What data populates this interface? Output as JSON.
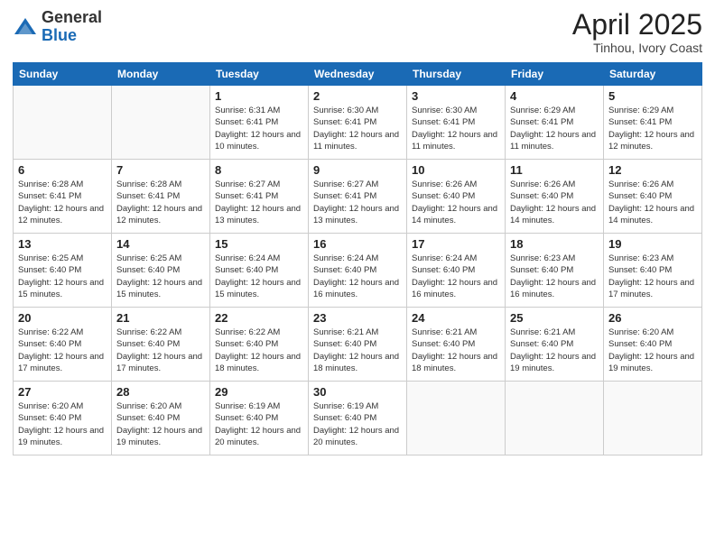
{
  "logo": {
    "general": "General",
    "blue": "Blue"
  },
  "title": {
    "month": "April 2025",
    "location": "Tinhou, Ivory Coast"
  },
  "days_of_week": [
    "Sunday",
    "Monday",
    "Tuesday",
    "Wednesday",
    "Thursday",
    "Friday",
    "Saturday"
  ],
  "weeks": [
    [
      {
        "day": "",
        "info": ""
      },
      {
        "day": "",
        "info": ""
      },
      {
        "day": "1",
        "info": "Sunrise: 6:31 AM\nSunset: 6:41 PM\nDaylight: 12 hours and 10 minutes."
      },
      {
        "day": "2",
        "info": "Sunrise: 6:30 AM\nSunset: 6:41 PM\nDaylight: 12 hours and 11 minutes."
      },
      {
        "day": "3",
        "info": "Sunrise: 6:30 AM\nSunset: 6:41 PM\nDaylight: 12 hours and 11 minutes."
      },
      {
        "day": "4",
        "info": "Sunrise: 6:29 AM\nSunset: 6:41 PM\nDaylight: 12 hours and 11 minutes."
      },
      {
        "day": "5",
        "info": "Sunrise: 6:29 AM\nSunset: 6:41 PM\nDaylight: 12 hours and 12 minutes."
      }
    ],
    [
      {
        "day": "6",
        "info": "Sunrise: 6:28 AM\nSunset: 6:41 PM\nDaylight: 12 hours and 12 minutes."
      },
      {
        "day": "7",
        "info": "Sunrise: 6:28 AM\nSunset: 6:41 PM\nDaylight: 12 hours and 12 minutes."
      },
      {
        "day": "8",
        "info": "Sunrise: 6:27 AM\nSunset: 6:41 PM\nDaylight: 12 hours and 13 minutes."
      },
      {
        "day": "9",
        "info": "Sunrise: 6:27 AM\nSunset: 6:41 PM\nDaylight: 12 hours and 13 minutes."
      },
      {
        "day": "10",
        "info": "Sunrise: 6:26 AM\nSunset: 6:40 PM\nDaylight: 12 hours and 14 minutes."
      },
      {
        "day": "11",
        "info": "Sunrise: 6:26 AM\nSunset: 6:40 PM\nDaylight: 12 hours and 14 minutes."
      },
      {
        "day": "12",
        "info": "Sunrise: 6:26 AM\nSunset: 6:40 PM\nDaylight: 12 hours and 14 minutes."
      }
    ],
    [
      {
        "day": "13",
        "info": "Sunrise: 6:25 AM\nSunset: 6:40 PM\nDaylight: 12 hours and 15 minutes."
      },
      {
        "day": "14",
        "info": "Sunrise: 6:25 AM\nSunset: 6:40 PM\nDaylight: 12 hours and 15 minutes."
      },
      {
        "day": "15",
        "info": "Sunrise: 6:24 AM\nSunset: 6:40 PM\nDaylight: 12 hours and 15 minutes."
      },
      {
        "day": "16",
        "info": "Sunrise: 6:24 AM\nSunset: 6:40 PM\nDaylight: 12 hours and 16 minutes."
      },
      {
        "day": "17",
        "info": "Sunrise: 6:24 AM\nSunset: 6:40 PM\nDaylight: 12 hours and 16 minutes."
      },
      {
        "day": "18",
        "info": "Sunrise: 6:23 AM\nSunset: 6:40 PM\nDaylight: 12 hours and 16 minutes."
      },
      {
        "day": "19",
        "info": "Sunrise: 6:23 AM\nSunset: 6:40 PM\nDaylight: 12 hours and 17 minutes."
      }
    ],
    [
      {
        "day": "20",
        "info": "Sunrise: 6:22 AM\nSunset: 6:40 PM\nDaylight: 12 hours and 17 minutes."
      },
      {
        "day": "21",
        "info": "Sunrise: 6:22 AM\nSunset: 6:40 PM\nDaylight: 12 hours and 17 minutes."
      },
      {
        "day": "22",
        "info": "Sunrise: 6:22 AM\nSunset: 6:40 PM\nDaylight: 12 hours and 18 minutes."
      },
      {
        "day": "23",
        "info": "Sunrise: 6:21 AM\nSunset: 6:40 PM\nDaylight: 12 hours and 18 minutes."
      },
      {
        "day": "24",
        "info": "Sunrise: 6:21 AM\nSunset: 6:40 PM\nDaylight: 12 hours and 18 minutes."
      },
      {
        "day": "25",
        "info": "Sunrise: 6:21 AM\nSunset: 6:40 PM\nDaylight: 12 hours and 19 minutes."
      },
      {
        "day": "26",
        "info": "Sunrise: 6:20 AM\nSunset: 6:40 PM\nDaylight: 12 hours and 19 minutes."
      }
    ],
    [
      {
        "day": "27",
        "info": "Sunrise: 6:20 AM\nSunset: 6:40 PM\nDaylight: 12 hours and 19 minutes."
      },
      {
        "day": "28",
        "info": "Sunrise: 6:20 AM\nSunset: 6:40 PM\nDaylight: 12 hours and 19 minutes."
      },
      {
        "day": "29",
        "info": "Sunrise: 6:19 AM\nSunset: 6:40 PM\nDaylight: 12 hours and 20 minutes."
      },
      {
        "day": "30",
        "info": "Sunrise: 6:19 AM\nSunset: 6:40 PM\nDaylight: 12 hours and 20 minutes."
      },
      {
        "day": "",
        "info": ""
      },
      {
        "day": "",
        "info": ""
      },
      {
        "day": "",
        "info": ""
      }
    ]
  ]
}
